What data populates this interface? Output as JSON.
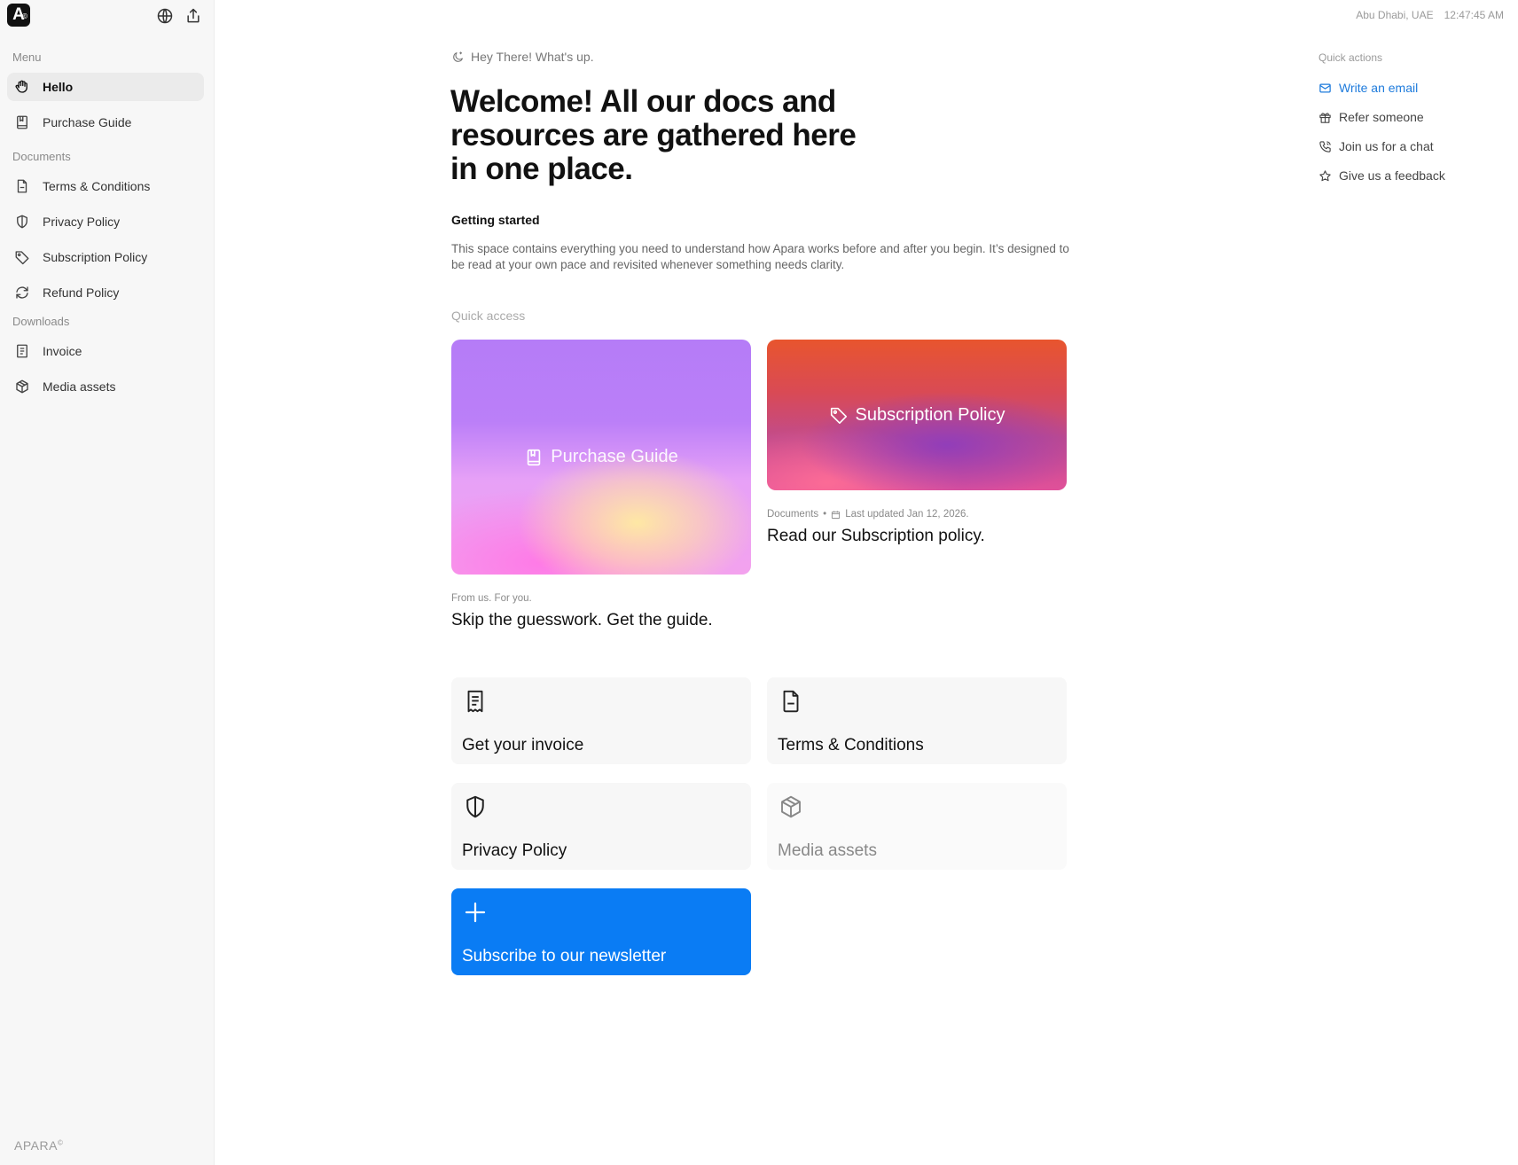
{
  "app": {
    "logo_text": "A",
    "logo_mark": "©",
    "brand_footer": "APARA",
    "brand_footer_mark": "©"
  },
  "topbar": {
    "location": "Abu Dhabi, UAE",
    "time": "12:47:45 AM",
    "icons": [
      "globe-icon",
      "share-icon"
    ]
  },
  "sidebar": {
    "sections": [
      {
        "label": "Menu",
        "items": [
          {
            "label": "Hello",
            "icon": "hand-icon",
            "active": true
          },
          {
            "label": "Purchase Guide",
            "icon": "book-icon",
            "active": false
          }
        ]
      },
      {
        "label": "Documents",
        "items": [
          {
            "label": "Terms & Conditions",
            "icon": "file-icon",
            "active": false
          },
          {
            "label": "Privacy Policy",
            "icon": "shield-icon",
            "active": false
          },
          {
            "label": "Subscription Policy",
            "icon": "tag-icon",
            "active": false
          },
          {
            "label": "Refund Policy",
            "icon": "refresh-icon",
            "active": false
          }
        ]
      },
      {
        "label": "Downloads",
        "items": [
          {
            "label": "Invoice",
            "icon": "receipt-icon",
            "active": false
          },
          {
            "label": "Media assets",
            "icon": "box-icon",
            "active": false
          }
        ]
      }
    ]
  },
  "main": {
    "greeting": "Hey There! What's up.",
    "headline": "Welcome! All our docs and resources are gathered here in one place.",
    "getting_started": {
      "title": "Getting started",
      "description": "This space contains everything you need to understand how Apara works before and after you begin. It’s designed to be read at your own pace and revisited whenever something needs clarity."
    },
    "quick_access_label": "Quick access",
    "featured": [
      {
        "image_label": "Purchase Guide",
        "icon": "book-icon",
        "meta": "From us. For you.",
        "title": "Skip the guesswork. Get the guide."
      },
      {
        "image_label": "Subscription Policy",
        "icon": "tag-icon",
        "meta_category": "Documents",
        "meta_separator": "•",
        "meta_date": "Last updated Jan 12, 2026.",
        "title": "Read our Subscription policy."
      }
    ],
    "tiles": [
      {
        "label": "Get your invoice",
        "icon": "receipt-icon",
        "style": "default"
      },
      {
        "label": "Terms & Conditions",
        "icon": "file-icon",
        "style": "default"
      },
      {
        "label": "Privacy Policy",
        "icon": "shield-icon",
        "style": "default"
      },
      {
        "label": "Media assets",
        "icon": "box-icon",
        "style": "muted"
      },
      {
        "label": "Subscribe to our newsletter",
        "icon": "plus-icon",
        "style": "primary",
        "color": "#0a7cf4"
      }
    ]
  },
  "quick_actions": {
    "title": "Quick actions",
    "items": [
      {
        "label": "Write an email",
        "icon": "mail-icon",
        "primary": true,
        "color": "#1e7bdc"
      },
      {
        "label": "Refer someone",
        "icon": "gift-icon",
        "primary": false
      },
      {
        "label": "Join us for a chat",
        "icon": "phone-icon",
        "primary": false
      },
      {
        "label": "Give us a feedback",
        "icon": "star-icon",
        "primary": false
      }
    ]
  }
}
